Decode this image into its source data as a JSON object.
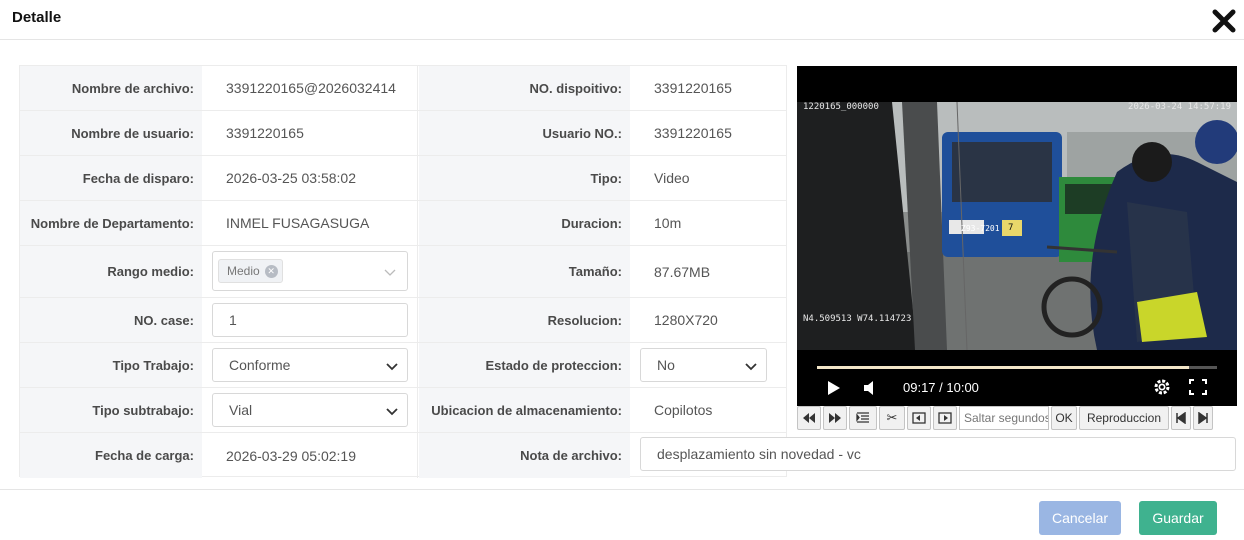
{
  "dialog": {
    "title": "Detalle"
  },
  "fields": {
    "nombre_archivo": {
      "label": "Nombre de archivo:",
      "value": "3391220165@2026032414"
    },
    "no_dispositivo": {
      "label": "NO. dispoitivo:",
      "value": "3391220165"
    },
    "nombre_usuario": {
      "label": "Nombre de usuario:",
      "value": "3391220165"
    },
    "usuario_no": {
      "label": "Usuario NO.:",
      "value": "3391220165"
    },
    "fecha_disparo": {
      "label": "Fecha de disparo:",
      "value": "2026-03-25 03:58:02"
    },
    "tipo": {
      "label": "Tipo:",
      "value": "Video"
    },
    "departamento": {
      "label": "Nombre de Departamento:",
      "value": "INMEL FUSAGASUGA"
    },
    "duracion": {
      "label": "Duracion:",
      "value": "10m"
    },
    "rango_medio": {
      "label": "Rango medio:",
      "tag": "Medio"
    },
    "tamano": {
      "label": "Tamaño:",
      "value": "87.67MB"
    },
    "no_case": {
      "label": "NO. case:",
      "value": "1"
    },
    "resolucion": {
      "label": "Resolucion:",
      "value": "1280X720"
    },
    "tipo_trabajo": {
      "label": "Tipo Trabajo:",
      "value": "Conforme"
    },
    "estado_proteccion": {
      "label": "Estado de proteccion:",
      "value": "No"
    },
    "tipo_subtrabajo": {
      "label": "Tipo subtrabajo:",
      "value": "Vial"
    },
    "ubicacion": {
      "label": "Ubicacion de almacenamiento:",
      "value": "Copilotos"
    },
    "fecha_carga": {
      "label": "Fecha de carga:",
      "value": "2026-03-29 05:02:19"
    },
    "nota": {
      "label": "Nota de archivo:",
      "value": "desplazamiento sin novedad - vc"
    }
  },
  "video": {
    "osd_left": "1220165_000000",
    "osd_right": "2026-03-24 14:57:19",
    "osd_coords": "N4.509513 W74.114723",
    "bus_route": "Z93-7201",
    "bus_number": "7",
    "time": "09:17 / 10:00",
    "progress": 0.93
  },
  "toolbar": {
    "jump_placeholder": "Saltar segundos",
    "ok_label": "OK",
    "playback_label": "Reproduccion"
  },
  "footer": {
    "cancel_label": "Cancelar",
    "save_label": "Guardar"
  },
  "colors": {
    "cancel": "#9ab6e3",
    "save": "#3fb28f"
  }
}
